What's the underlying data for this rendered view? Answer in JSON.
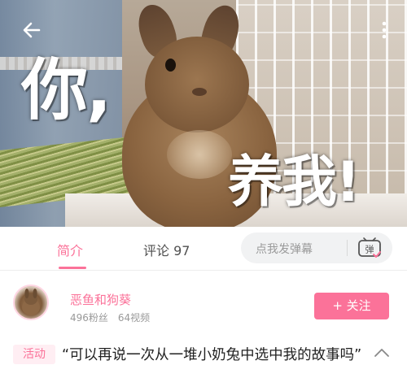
{
  "video": {
    "overlay_line1": "你,",
    "overlay_line2": "养我!"
  },
  "tabs": {
    "intro": "简介",
    "comments": "评论 97"
  },
  "danmaku": {
    "placeholder": "点我发弹幕",
    "toggle_icon": "弹"
  },
  "uploader": {
    "name": "恶鱼和狗葵",
    "stats": "496粉丝　64视频",
    "follow_label": "+ 关注"
  },
  "title": {
    "badge": "活动",
    "text": "“可以再说一次从一堆小奶兔中选中我的故事吗”"
  },
  "colors": {
    "accent": "#fb7299",
    "accent_light": "#ffeef3"
  },
  "icons": [
    "back-arrow-icon",
    "more-vertical-icon",
    "danmaku-toggle-icon",
    "chevron-up-icon"
  ]
}
